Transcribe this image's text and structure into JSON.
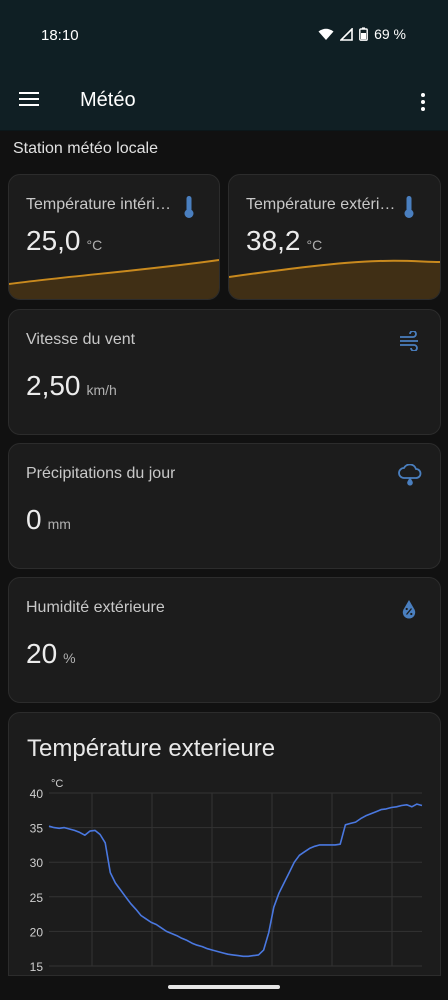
{
  "status_bar": {
    "time": "18:10",
    "battery": "69 %"
  },
  "app_bar": {
    "title": "Météo"
  },
  "section": {
    "title": "Station météo locale"
  },
  "cards": {
    "temp_int": {
      "name": "Température intérieure",
      "value": "25,0",
      "unit": "°C",
      "icon": "thermometer-icon"
    },
    "temp_ext": {
      "name": "Température extérieure",
      "value": "38,2",
      "unit": "°C",
      "icon": "thermometer-icon"
    },
    "wind": {
      "name": "Vitesse du vent",
      "value": "2,50",
      "unit": "km/h",
      "icon": "wind-icon"
    },
    "rain": {
      "name": "Précipitations du jour",
      "value": "0",
      "unit": "mm",
      "icon": "rain-cloud-icon"
    },
    "humidity": {
      "name": "Humidité extérieure",
      "value": "20",
      "unit": "%",
      "icon": "humidity-drop-icon"
    }
  },
  "colors": {
    "accent": "#4a7fbf",
    "sparkline": "#c98a1e",
    "chart_line": "#4a78e0"
  },
  "chart_data": {
    "type": "line",
    "title": "Température exterieure",
    "ylabel": "°C",
    "ylim": [
      15,
      40
    ],
    "yticks": [
      15,
      20,
      25,
      30,
      35,
      40
    ],
    "series": [
      {
        "values": [
          35.2,
          35.0,
          34.9,
          35.0,
          34.8,
          34.6,
          34.3,
          33.9,
          34.5,
          34.6,
          34.0,
          32.8,
          28.5,
          27.0,
          26.0,
          25.0,
          24.0,
          23.2,
          22.3,
          21.8,
          21.3,
          21.0,
          20.5,
          20.0,
          19.7,
          19.4,
          19.0,
          18.7,
          18.3,
          18.0,
          17.8,
          17.5,
          17.3,
          17.1,
          16.9,
          16.7,
          16.6,
          16.5,
          16.4,
          16.4,
          16.5,
          16.6,
          17.3,
          19.8,
          23.5,
          25.5,
          27.0,
          28.5,
          30.0,
          31.0,
          31.5,
          32.0,
          32.3,
          32.5,
          32.5,
          32.5,
          32.5,
          32.6,
          35.4,
          35.6,
          35.8,
          36.3,
          36.7,
          37.0,
          37.3,
          37.6,
          37.7,
          37.9,
          38.0,
          38.2,
          38.3,
          38.0,
          38.4,
          38.2
        ]
      }
    ],
    "xlim": [
      0,
      73
    ],
    "grid": true
  }
}
